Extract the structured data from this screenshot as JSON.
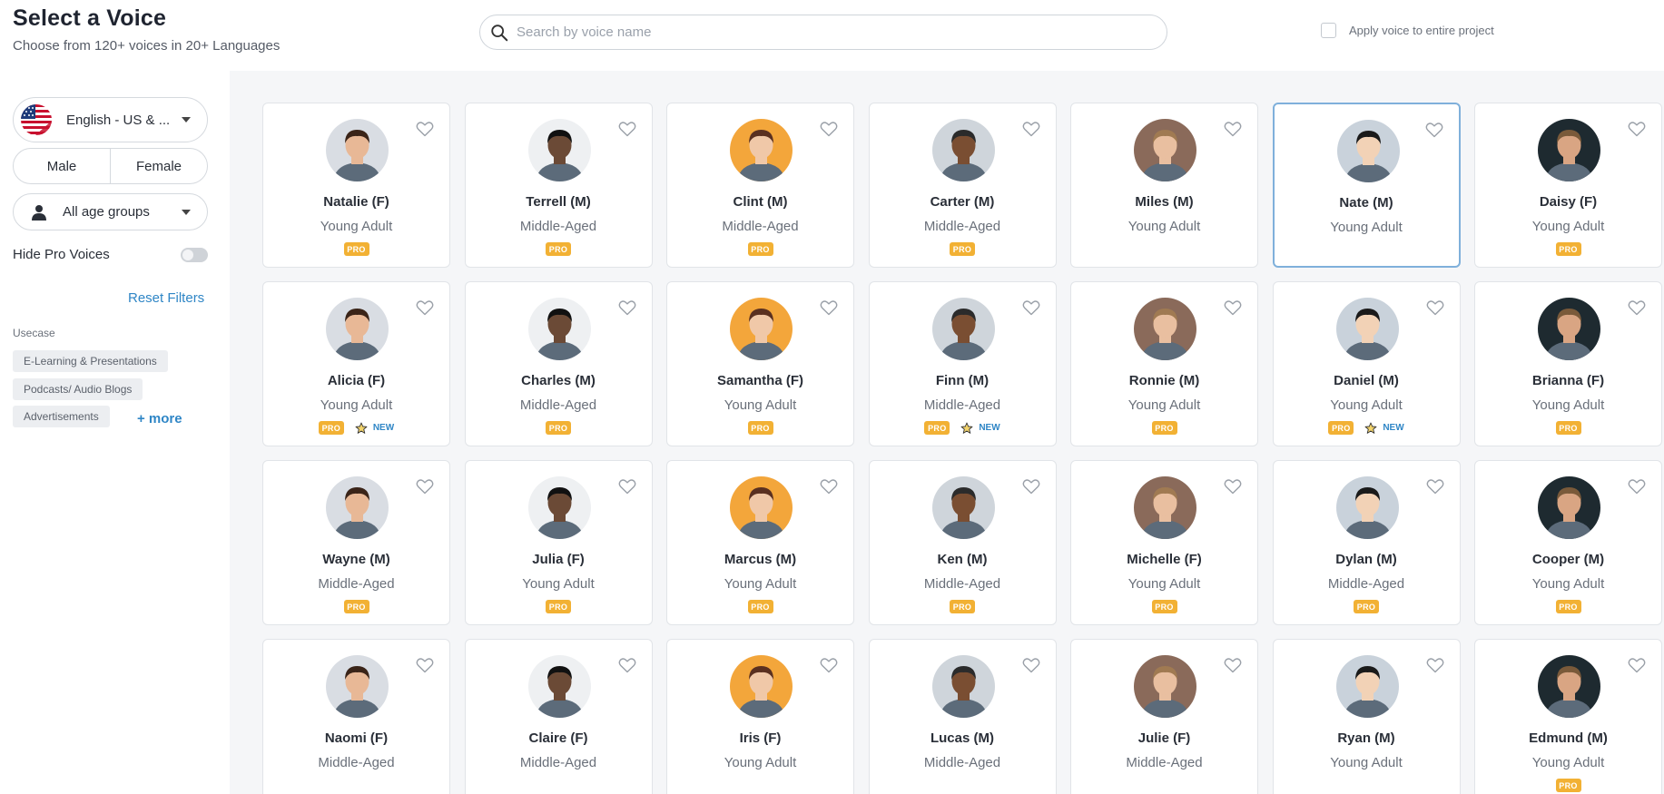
{
  "header": {
    "title": "Select a Voice",
    "subtitle": "Choose from 120+ voices in 20+ Languages",
    "search_placeholder": "Search by voice name",
    "apply_label": "Apply voice to entire project"
  },
  "sidebar": {
    "language": "English - US & ...",
    "gender": [
      "Male",
      "Female"
    ],
    "age": "All age groups",
    "hide_pro_label": "Hide Pro Voices",
    "hide_pro_on": false,
    "reset_label": "Reset Filters",
    "usecase_label": "Usecase",
    "usecases": [
      "E-Learning & Presentations",
      "Podcasts/ Audio Blogs",
      "Advertisements"
    ],
    "more_label": "+ more"
  },
  "badge_labels": {
    "pro": "PRO",
    "new": "NEW"
  },
  "colors": {
    "pro_badge": "#f2b134",
    "accent": "#2f86c6",
    "selected_border": "#7fb0db"
  },
  "voices": [
    {
      "name": "Natalie (F)",
      "age": "Young Adult",
      "pro": true,
      "new": false,
      "selected": false
    },
    {
      "name": "Terrell (M)",
      "age": "Middle-Aged",
      "pro": true,
      "new": false,
      "selected": false
    },
    {
      "name": "Clint (M)",
      "age": "Middle-Aged",
      "pro": true,
      "new": false,
      "selected": false
    },
    {
      "name": "Carter (M)",
      "age": "Middle-Aged",
      "pro": true,
      "new": false,
      "selected": false
    },
    {
      "name": "Miles (M)",
      "age": "Young Adult",
      "pro": false,
      "new": false,
      "selected": false
    },
    {
      "name": "Nate (M)",
      "age": "Young Adult",
      "pro": false,
      "new": false,
      "selected": true
    },
    {
      "name": "Daisy (F)",
      "age": "Young Adult",
      "pro": true,
      "new": false,
      "selected": false
    },
    {
      "name": "Alicia (F)",
      "age": "Young Adult",
      "pro": true,
      "new": true,
      "selected": false
    },
    {
      "name": "Charles (M)",
      "age": "Middle-Aged",
      "pro": true,
      "new": false,
      "selected": false
    },
    {
      "name": "Samantha (F)",
      "age": "Young Adult",
      "pro": true,
      "new": false,
      "selected": false
    },
    {
      "name": "Finn (M)",
      "age": "Middle-Aged",
      "pro": true,
      "new": true,
      "selected": false
    },
    {
      "name": "Ronnie (M)",
      "age": "Young Adult",
      "pro": true,
      "new": false,
      "selected": false
    },
    {
      "name": "Daniel (M)",
      "age": "Young Adult",
      "pro": true,
      "new": true,
      "selected": false
    },
    {
      "name": "Brianna (F)",
      "age": "Young Adult",
      "pro": true,
      "new": false,
      "selected": false
    },
    {
      "name": "Wayne (M)",
      "age": "Middle-Aged",
      "pro": true,
      "new": false,
      "selected": false
    },
    {
      "name": "Julia (F)",
      "age": "Young Adult",
      "pro": true,
      "new": false,
      "selected": false
    },
    {
      "name": "Marcus (M)",
      "age": "Young Adult",
      "pro": true,
      "new": false,
      "selected": false
    },
    {
      "name": "Ken (M)",
      "age": "Middle-Aged",
      "pro": true,
      "new": false,
      "selected": false
    },
    {
      "name": "Michelle (F)",
      "age": "Young Adult",
      "pro": true,
      "new": false,
      "selected": false
    },
    {
      "name": "Dylan (M)",
      "age": "Middle-Aged",
      "pro": true,
      "new": false,
      "selected": false
    },
    {
      "name": "Cooper (M)",
      "age": "Young Adult",
      "pro": true,
      "new": false,
      "selected": false
    },
    {
      "name": "Naomi (F)",
      "age": "Middle-Aged",
      "pro": false,
      "new": false,
      "selected": false
    },
    {
      "name": "Claire (F)",
      "age": "Middle-Aged",
      "pro": false,
      "new": false,
      "selected": false
    },
    {
      "name": "Iris (F)",
      "age": "Young Adult",
      "pro": false,
      "new": false,
      "selected": false
    },
    {
      "name": "Lucas (M)",
      "age": "Middle-Aged",
      "pro": false,
      "new": false,
      "selected": false
    },
    {
      "name": "Julie (F)",
      "age": "Middle-Aged",
      "pro": false,
      "new": false,
      "selected": false
    },
    {
      "name": "Ryan (M)",
      "age": "Young Adult",
      "pro": false,
      "new": false,
      "selected": false
    },
    {
      "name": "Edmund (M)",
      "age": "Young Adult",
      "pro": true,
      "new": false,
      "selected": false
    }
  ]
}
